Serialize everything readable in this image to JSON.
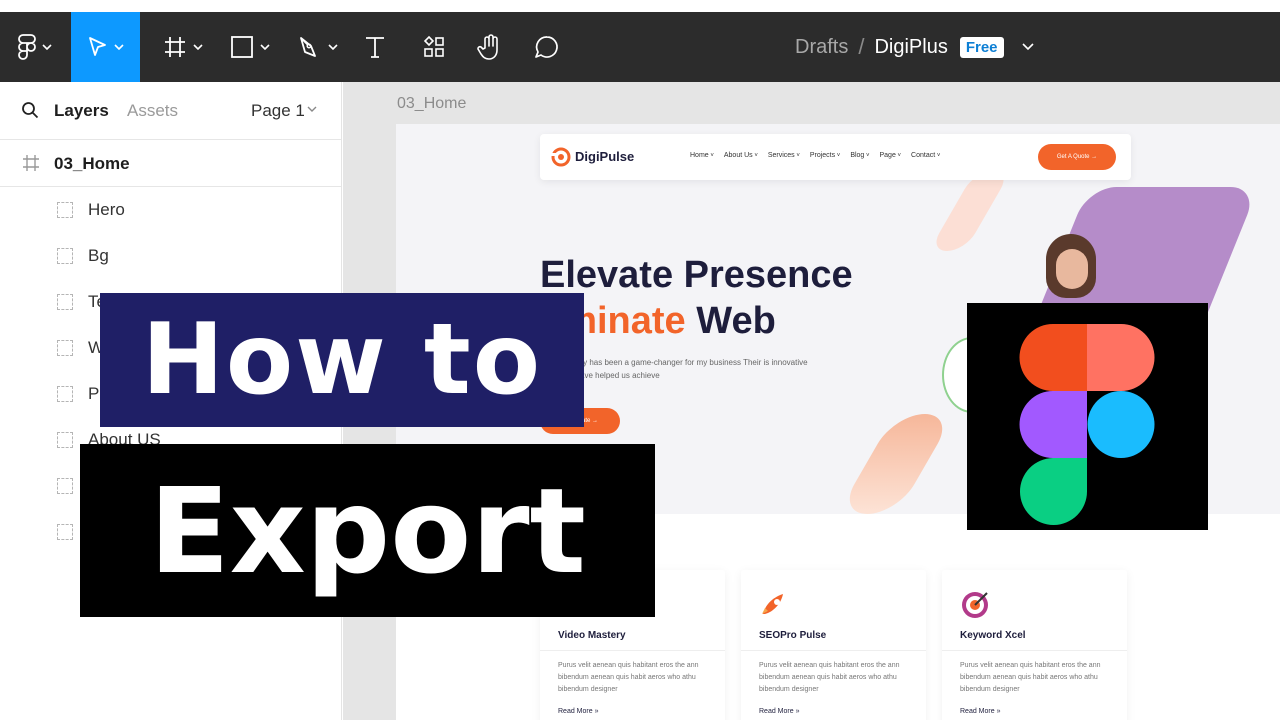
{
  "toolbar": {
    "tools": [
      {
        "name": "main-menu",
        "icon": "figma-menu-icon"
      },
      {
        "name": "move-tool",
        "icon": "move-cursor-icon",
        "active": true
      },
      {
        "name": "frame-tool",
        "icon": "frame-hash-icon"
      },
      {
        "name": "shape-tool",
        "icon": "rectangle-icon"
      },
      {
        "name": "pen-tool",
        "icon": "pen-icon"
      },
      {
        "name": "text-tool",
        "icon": "text-t-icon"
      },
      {
        "name": "resources-tool",
        "icon": "resources-icon"
      },
      {
        "name": "hand-tool",
        "icon": "hand-icon"
      },
      {
        "name": "comment-tool",
        "icon": "comment-bubble-icon"
      }
    ],
    "accent_color": "#0d99ff",
    "background_color": "#2c2c2c"
  },
  "breadcrumb": {
    "location": "Drafts",
    "separator": "/",
    "file_name": "DigiPlus",
    "plan_badge": "Free"
  },
  "left_panel": {
    "tab_layers": "Layers",
    "tab_assets": "Assets",
    "page_selector": "Page 1",
    "frame_name": "03_Home",
    "layers": [
      "Hero",
      "Bg",
      "Te",
      "W",
      "Pr",
      "About US",
      "",
      ""
    ]
  },
  "canvas": {
    "frame_label": "03_Home",
    "site": {
      "logo_text": "DigiPulse",
      "nav": [
        "Home",
        "About Us",
        "Services",
        "Projects",
        "Blog",
        "Page",
        "Contact"
      ],
      "cta_label": "Get A Quote →",
      "hero_line1": "Elevate Presence",
      "hero_line2_accent": "ominate",
      "hero_line2_rest": " Web",
      "hero_desc": "this company has been a game-changer for my business Their is innovative approach have helped us achieve",
      "hero_button": "ate →",
      "cards": [
        {
          "title": "Video Mastery",
          "desc": "Purus velit aenean quis habitant eros the ann bibendum aenean quis habit aeros who athu bibendum designer",
          "link": "Read More »"
        },
        {
          "title": "SEOPro Pulse",
          "desc": "Purus velit aenean quis habitant eros the ann bibendum aenean quis habit aeros who athu bibendum designer",
          "link": "Read More »"
        },
        {
          "title": "Keyword Xcel",
          "desc": "Purus velit aenean quis habitant eros the ann bibendum aenean quis habit aeros who athu bibendum designer",
          "link": "Read More »"
        }
      ],
      "brand_color": "#f2642a"
    }
  },
  "overlay": {
    "line1": "How to",
    "line2": "Export",
    "logo": "figma-logo-icon",
    "logo_colors": [
      "#f24e1e",
      "#ff7262",
      "#a259ff",
      "#1abcfe",
      "#0acf83"
    ]
  }
}
